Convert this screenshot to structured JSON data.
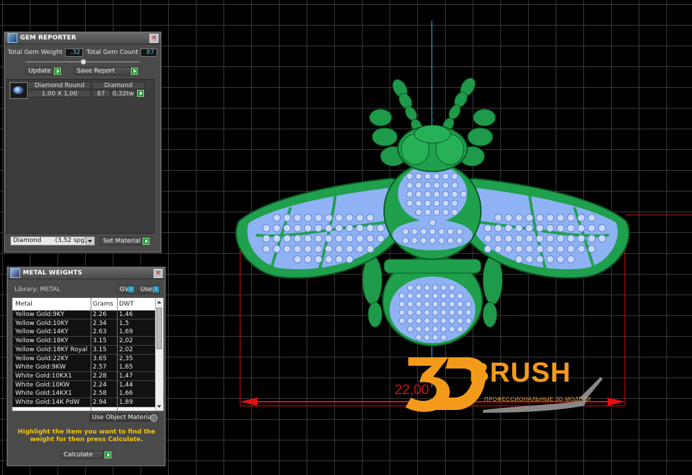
{
  "gem_reporter": {
    "title": "GEM REPORTER",
    "total_gem_weight_label": "Total Gem Weight",
    "total_gem_weight_value": ".32",
    "total_gem_count_label": "Total Gem Count",
    "total_gem_count_value": "87",
    "update_label": "Update",
    "save_report_label": "Save Report",
    "gem_row": {
      "shape_name": "Diamond Round",
      "material_name": "Diamond",
      "size": "1,00 X 1,00",
      "count": "87",
      "weight": "0,32tw"
    },
    "material_select_value": "Diamond       (3,52 spg)",
    "set_material_label": "Set Material"
  },
  "metal_weights": {
    "title": "METAL WEIGHTS",
    "library_label": "Library: METAL",
    "gv_label": "GV",
    "user_label": "User",
    "columns": [
      "Metal",
      "Grams",
      "DWT"
    ],
    "rows": [
      {
        "metal": "Yellow Gold:9KY",
        "grams": "2.26",
        "dwt": "1,46"
      },
      {
        "metal": "Yellow Gold:10KY",
        "grams": "2.34",
        "dwt": "1,5"
      },
      {
        "metal": "Yellow Gold:14KY",
        "grams": "2.63",
        "dwt": "1,69"
      },
      {
        "metal": "Yellow Gold:18KY",
        "grams": "3.15",
        "dwt": "2,02"
      },
      {
        "metal": "Yellow Gold:18KY Royal",
        "grams": "3.15",
        "dwt": "2,02"
      },
      {
        "metal": "Yellow Gold:22KY",
        "grams": "3.65",
        "dwt": "2,35"
      },
      {
        "metal": "White Gold:9KW",
        "grams": "2.57",
        "dwt": "1,65"
      },
      {
        "metal": "White Gold:10KX1",
        "grams": "2.28",
        "dwt": "1,47"
      },
      {
        "metal": "White Gold:10KW",
        "grams": "2.24",
        "dwt": "1,44"
      },
      {
        "metal": "White Gold:14KX1",
        "grams": "2.58",
        "dwt": "1,66"
      },
      {
        "metal": "White Gold:14K PdW",
        "grams": "2.94",
        "dwt": "1,89"
      }
    ],
    "use_object_materials_label": "Use Object Materials",
    "instruction_text": "Highlight the item you want to find the weight for then press Calculate.",
    "calculate_label": "Calculate"
  },
  "viewport": {
    "dimension_value": "22,00"
  },
  "watermark": {
    "brand": "3DBRUSH",
    "tagline": "ПРОФЕССИОНАЛЬНЫЕ 3D МОДЕЛИ"
  },
  "colors": {
    "metal_green": "#1e9e4a",
    "gem_blue": "#8fb2f5",
    "accent_cyan": "#39d3e6",
    "brand_orange": "#f49a1a",
    "dim_red": "#e01010"
  }
}
